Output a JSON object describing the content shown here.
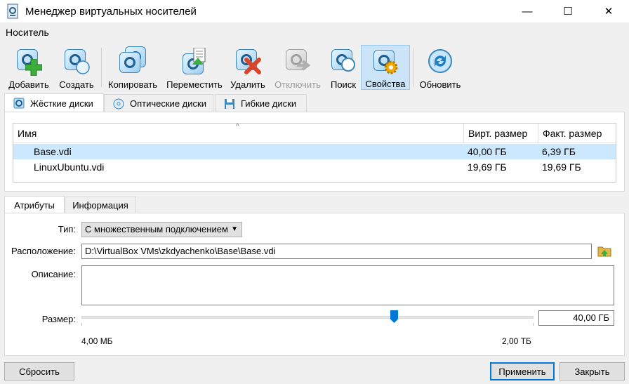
{
  "window": {
    "title": "Менеджер виртуальных носителей",
    "minimize": "—",
    "maximize": "☐",
    "close": "✕"
  },
  "menu": {
    "media": "Носитель"
  },
  "toolbar": {
    "add": "Добавить",
    "create": "Создать",
    "copy": "Копировать",
    "move": "Переместить",
    "remove": "Удалить",
    "release": "Отключить",
    "search": "Поиск",
    "properties": "Свойства",
    "refresh": "Обновить"
  },
  "media_tabs": {
    "hard": "Жёсткие диски",
    "optical": "Оптические диски",
    "floppy": "Гибкие диски"
  },
  "list": {
    "headers": {
      "name": "Имя",
      "virtual_size": "Вирт. размер",
      "actual_size": "Факт. размер"
    },
    "rows": [
      {
        "name": "Base.vdi",
        "virtual_size": "40,00 ГБ",
        "actual_size": "6,39 ГБ",
        "selected": true
      },
      {
        "name": "LinuxUbuntu.vdi",
        "virtual_size": "19,69 ГБ",
        "actual_size": "19,69 ГБ",
        "selected": false
      }
    ]
  },
  "detail_tabs": {
    "attributes": "Атрибуты",
    "information": "Информация"
  },
  "attributes": {
    "type_label": "Тип:",
    "type_value": "С множественным подключением",
    "location_label": "Расположение:",
    "location_value": "D:\\VirtualBox VMs\\zkdyachenko\\Base\\Base.vdi",
    "description_label": "Описание:",
    "description_value": "",
    "size_label": "Размер:",
    "size_value": "40,00 ГБ",
    "size_min": "4,00 МБ",
    "size_max": "2,00 ТБ"
  },
  "buttons": {
    "reset": "Сбросить",
    "apply": "Применить",
    "close": "Закрыть"
  },
  "colors": {
    "accent": "#0078d7",
    "selection": "#cce8ff",
    "toolbar_active": "#cce4f7"
  }
}
